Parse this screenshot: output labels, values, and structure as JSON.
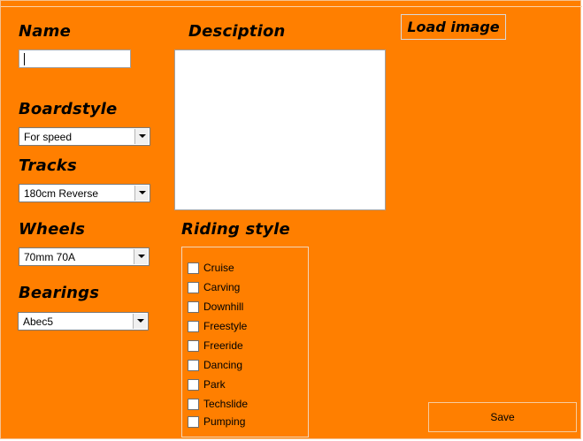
{
  "labels": {
    "name": "Name",
    "description": "Desciption",
    "boardstyle": "Boardstyle",
    "tracks": "Tracks",
    "wheels": "Wheels",
    "bearings": "Bearings",
    "riding_style": "Riding style"
  },
  "name_input": {
    "value": ""
  },
  "description_input": {
    "value": ""
  },
  "combos": {
    "boardstyle": "For speed",
    "tracks": "180cm Reverse",
    "wheels": "70mm 70A",
    "bearings": "Abec5"
  },
  "riding_styles": [
    {
      "label": "Cruise",
      "checked": false
    },
    {
      "label": "Carving",
      "checked": false
    },
    {
      "label": "Downhill",
      "checked": false
    },
    {
      "label": "Freestyle",
      "checked": false
    },
    {
      "label": "Freeride",
      "checked": false
    },
    {
      "label": "Dancing",
      "checked": false
    },
    {
      "label": "Park",
      "checked": false
    },
    {
      "label": "Techslide",
      "checked": false
    },
    {
      "label": "Pumping",
      "checked": false
    }
  ],
  "buttons": {
    "load_image": "Load image",
    "save": "Save"
  },
  "colors": {
    "background": "#ff7f00"
  }
}
